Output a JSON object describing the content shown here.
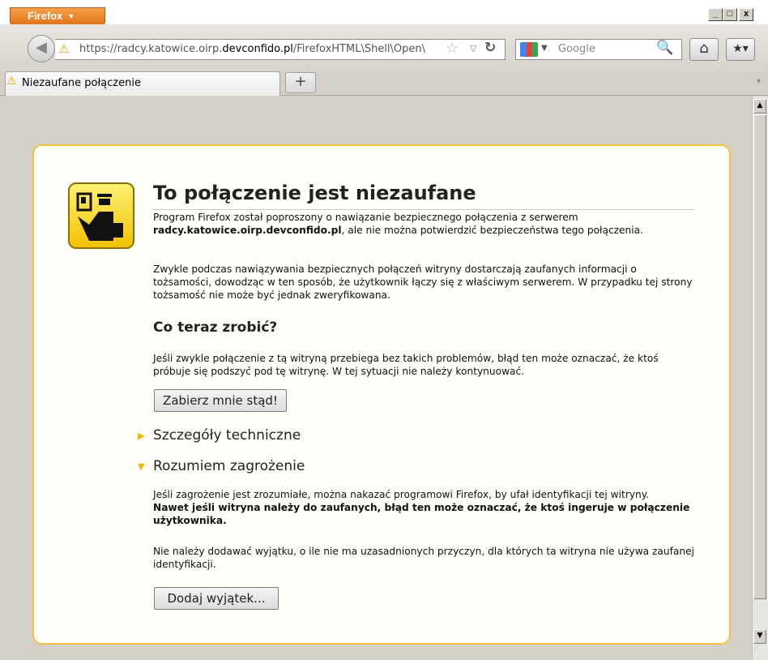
{
  "window": {
    "app_button": "Firefox",
    "controls": [
      "_",
      "□",
      "x"
    ]
  },
  "nav": {
    "url_prefix": "https://radcy.katowice.oirp.",
    "url_domain": "devconfido.pl",
    "url_suffix": "/FirefoxHTML\\Shell\\Open\\",
    "search_placeholder": "Google"
  },
  "tabs": [
    {
      "label": "Niezaufane połączenie",
      "icon": "warning-icon"
    }
  ],
  "new_tab_label": "+",
  "page": {
    "title": "To połączenie jest niezaufane",
    "p1_a": "Program Firefox został poproszony o nawiązanie bezpiecznego połączenia z serwerem",
    "p1_host": "radcy.katowice.oirp.devconfido.pl",
    "p1_b": ", ale nie można potwierdzić bezpieczeństwa tego połączenia.",
    "p2": "Zwykle podczas nawiązywania bezpiecznych połączeń witryny dostarczają zaufanych informacji o tożsamości, dowodząc w ten sposób, że użytkownik łączy się z właściwym serwerem. W przypadku tej strony tożsamość nie może być jednak zweryfikowana.",
    "what_now_heading": "Co teraz zrobić?",
    "p3": "Jeśli zwykle połączenie z tą witryną przebiega bez takich problemów, błąd ten może oznaczać, że ktoś próbuje się podszyć pod tę witrynę. W tej sytuacji nie należy kontynuować.",
    "get_me_out_button": "Zabierz mnie stąd!",
    "technical_details": "Szczegóły techniczne",
    "understand_risks": "Rozumiem zagrożenie",
    "p4_a": "Jeśli zagrożenie jest zrozumiałe, można nakazać programowi Firefox, by ufał identyfikacji tej witryny.",
    "p4_b": "Nawet jeśli witryna należy do zaufanych, błąd ten może oznaczać, że ktoś ingeruje w połączenie użytkownika.",
    "p5": "Nie należy dodawać wyjątku, o ile nie ma uzasadnionych przyczyn, dla których ta witryna nie używa zaufanej identyfikacji.",
    "add_exception_button": "Dodaj wyjątek..."
  },
  "colors": {
    "accent": "#f2c445",
    "firefox_button": "#e1741b",
    "warning": "#e5a800"
  }
}
